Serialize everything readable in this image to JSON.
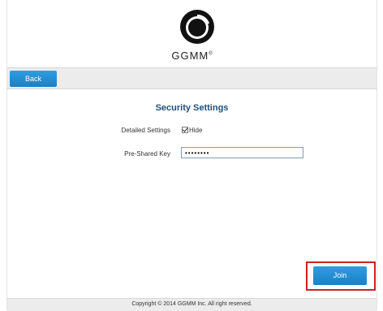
{
  "brand": {
    "name": "GGMM",
    "trademark": "®"
  },
  "toolbar": {
    "back_label": "Back"
  },
  "security": {
    "title": "Security Settings",
    "detailed_label": "Detailed Settings",
    "hide_label": "Hide",
    "hide_checked": true,
    "psk_label": "Pre-Shared Key",
    "psk_value": "••••••••"
  },
  "actions": {
    "join_label": "Join"
  },
  "footer": {
    "copyright": "Copyright © 2014 GGMM Inc. All right reserved."
  },
  "colors": {
    "button_blue": "#1a80c4",
    "title_blue": "#1f4e79",
    "highlight_red": "#d11f1f"
  }
}
